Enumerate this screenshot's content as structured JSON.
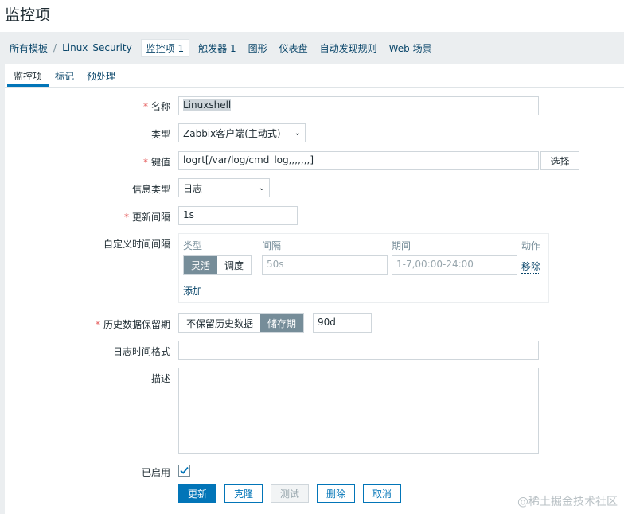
{
  "page": {
    "title": "监控项"
  },
  "breadcrumb": {
    "items": [
      "所有模板",
      "Linux_Security",
      "监控项 1",
      "触发器 1",
      "图形",
      "仪表盘",
      "自动发现规则",
      "Web 场景"
    ]
  },
  "tabs": [
    "监控项",
    "标记",
    "预处理"
  ],
  "form": {
    "name": {
      "label": "名称",
      "value": "Linuxshell"
    },
    "type": {
      "label": "类型",
      "value": "Zabbix客户端(主动式)"
    },
    "key": {
      "label": "键值",
      "value": "logrt[/var/log/cmd_log,,,,,,,]",
      "select_button": "选择"
    },
    "info_type": {
      "label": "信息类型",
      "value": "日志"
    },
    "update_interval": {
      "label": "更新间隔",
      "value": "1s"
    },
    "custom_intervals": {
      "label": "自定义时间间隔",
      "headers": {
        "type": "类型",
        "interval": "间隔",
        "period": "期间",
        "action": "动作"
      },
      "segment": {
        "flexible": "灵活",
        "scheduling": "调度"
      },
      "interval_placeholder": "50s",
      "period_placeholder": "1-7,00:00-24:00",
      "remove": "移除",
      "add": "添加"
    },
    "history": {
      "label": "历史数据保留期",
      "no_keep": "不保留历史数据",
      "storage": "储存期",
      "value": "90d"
    },
    "log_time_format": {
      "label": "日志时间格式",
      "value": ""
    },
    "description": {
      "label": "描述",
      "value": ""
    },
    "enabled": {
      "label": "已启用"
    }
  },
  "buttons": {
    "update": "更新",
    "clone": "克隆",
    "test": "测试",
    "delete": "删除",
    "cancel": "取消"
  },
  "watermark": "@稀土掘金技术社区"
}
